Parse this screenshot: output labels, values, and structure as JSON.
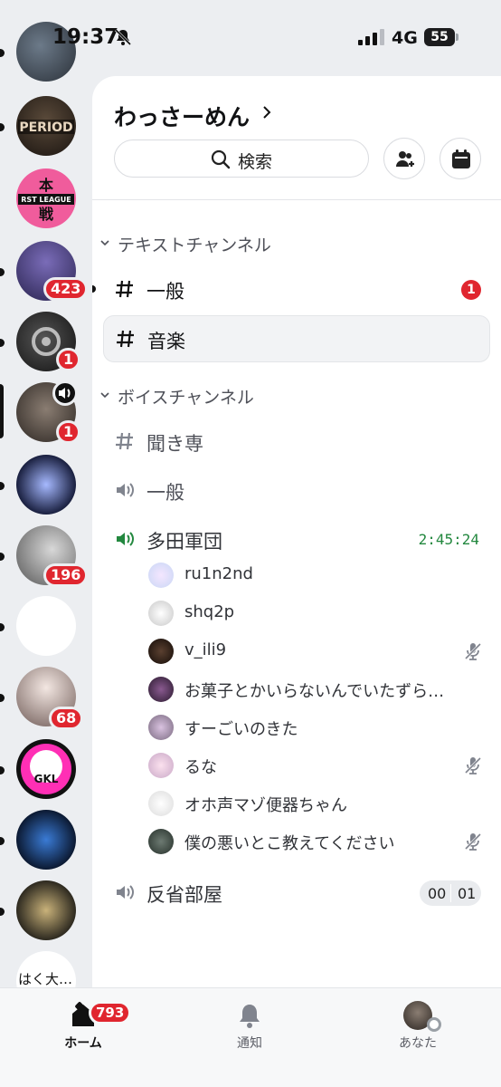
{
  "status_bar": {
    "time": "19:37",
    "network": "4G",
    "battery": "55"
  },
  "rail": {
    "servers": [
      {
        "name": "server-youtube",
        "badge": null
      },
      {
        "name": "server-period",
        "badge": null
      },
      {
        "name": "server-first-league",
        "badge": null
      },
      {
        "name": "server-knight",
        "badge": "423"
      },
      {
        "name": "server-gear",
        "badge": "1"
      },
      {
        "name": "server-active-voice",
        "badge": "1"
      },
      {
        "name": "server-official",
        "badge": null
      },
      {
        "name": "server-mono",
        "badge": "196"
      },
      {
        "name": "server-blank",
        "badge": null
      },
      {
        "name": "server-anime",
        "badge": "68"
      },
      {
        "name": "server-gkl",
        "badge": null
      },
      {
        "name": "server-wolf",
        "badge": null
      },
      {
        "name": "server-emblem",
        "badge": null
      }
    ],
    "bottom_label": "はく大…"
  },
  "header": {
    "server_name": "わっさーめん",
    "search_label": "検索"
  },
  "categories": {
    "text": "テキストチャンネル",
    "voice": "ボイスチャンネル"
  },
  "text_channels": [
    {
      "name": "一般",
      "unread": "1"
    },
    {
      "name": "音楽"
    }
  ],
  "voice_channels": [
    {
      "name": "聞き専"
    },
    {
      "name": "一般"
    },
    {
      "name": "多田軍団",
      "timer": "2:45:24"
    },
    {
      "name": "反省部屋",
      "count_left": "00",
      "count_right": "01"
    }
  ],
  "voice_users": [
    {
      "name": "ru1n2nd",
      "muted": false
    },
    {
      "name": "shq2p",
      "muted": false
    },
    {
      "name": "v_ili9",
      "muted": true
    },
    {
      "name": "お菓子とかいらないんでいたずら…",
      "muted": false
    },
    {
      "name": "すーごいのきた",
      "muted": false
    },
    {
      "name": "るな",
      "muted": true
    },
    {
      "name": "オホ声マゾ便器ちゃん",
      "muted": false
    },
    {
      "name": "僕の悪いとこ教えてください",
      "muted": true
    }
  ],
  "nav": {
    "home": "ホーム",
    "home_badge": "793",
    "notifications": "通知",
    "you": "あなた"
  },
  "colors": {
    "badge": "#e0262f",
    "voice_active": "#23883f",
    "panel": "#ffffff",
    "rail": "#eceef1"
  }
}
